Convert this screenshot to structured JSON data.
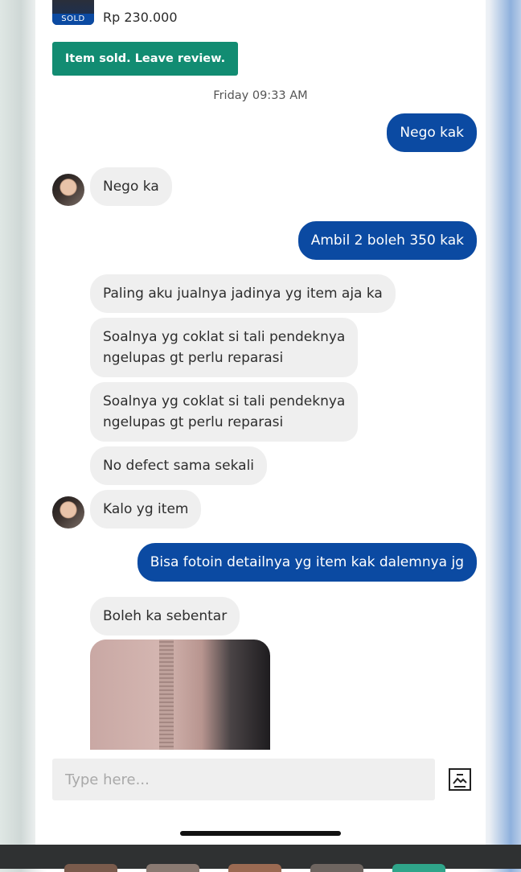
{
  "item": {
    "sold_badge": "SOLD",
    "price": "Rp 230.000"
  },
  "review_button": "Item sold. Leave review.",
  "timestamp": "Friday 09:33 AM",
  "messages": [
    {
      "text": "Nego kak",
      "from": "me"
    },
    {
      "text": "Nego ka",
      "from": "other"
    },
    {
      "text": "Ambil 2 boleh 350 kak",
      "from": "me"
    },
    {
      "text": "Paling aku jualnya jadinya yg item aja ka",
      "from": "other"
    },
    {
      "line1": "Soalnya yg coklat si tali pendeknya",
      "line2": "ngelupas gt perlu reparasi",
      "from": "other"
    },
    {
      "line1": "Soalnya yg coklat si tali pendeknya",
      "line2": "ngelupas gt perlu reparasi",
      "from": "other"
    },
    {
      "text": "No defect sama sekali",
      "from": "other"
    },
    {
      "text": "Kalo yg item",
      "from": "other"
    },
    {
      "text": "Bisa fotoin detailnya yg item kak dalemnya jg",
      "from": "me"
    },
    {
      "text": "Boleh ka sebentar",
      "from": "other"
    }
  ],
  "input": {
    "placeholder": "Type here..."
  },
  "colors": {
    "accent": "#0b4aa2",
    "review_green": "#128c72",
    "incoming_bg": "#efefef"
  },
  "icons": {
    "attach": "image-upload-icon"
  }
}
